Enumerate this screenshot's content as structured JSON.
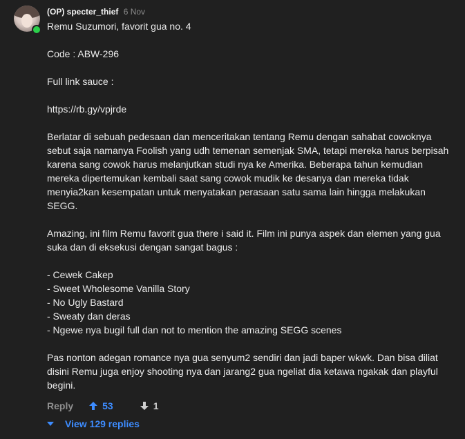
{
  "comment": {
    "username": "(OP) specter_thief",
    "timestamp": "6 Nov",
    "paragraphs": [
      "Remu Suzumori, favorit gua no. 4",
      "Code : ABW-296",
      "Full link sauce :",
      "https://rb.gy/vpjrde",
      "Berlatar di sebuah pedesaan dan menceritakan tentang Remu dengan sahabat cowoknya sebut saja namanya Foolish yang udh temenan semenjak SMA, tetapi mereka harus berpisah karena sang cowok harus melanjutkan studi nya ke Amerika. Beberapa tahun kemudian mereka dipertemukan kembali saat sang cowok mudik ke desanya dan mereka tidak menyia2kan kesempatan untuk menyatakan perasaan satu sama lain hingga melakukan SEGG.",
      "Amazing, ini film Remu favorit gua there i said it. Film ini punya aspek dan elemen yang gua suka dan di eksekusi dengan sangat bagus :"
    ],
    "list_items": [
      "- Cewek Cakep",
      "- Sweet Wholesome Vanilla Story",
      "- No Ugly Bastard",
      "- Sweaty dan deras",
      "- Ngewe nya bugil full dan not to mention the amazing SEGG scenes"
    ],
    "closing": "Pas nonton adegan romance nya gua senyum2 sendiri dan jadi baper wkwk. Dan bisa diliat disini Remu juga enjoy shooting nya dan jarang2 gua ngeliat dia ketawa ngakak dan playful begini."
  },
  "actions": {
    "reply_label": "Reply",
    "upvotes": "53",
    "downvotes": "1",
    "view_replies_label": "View 129 replies"
  },
  "colors": {
    "background": "#202020",
    "accent": "#3d8cff",
    "online": "#2bd04b"
  },
  "icons": {
    "upvote": "arrow-up-icon",
    "downvote": "arrow-down-icon",
    "expand": "chevron-down-icon",
    "online": "online-status-icon"
  }
}
